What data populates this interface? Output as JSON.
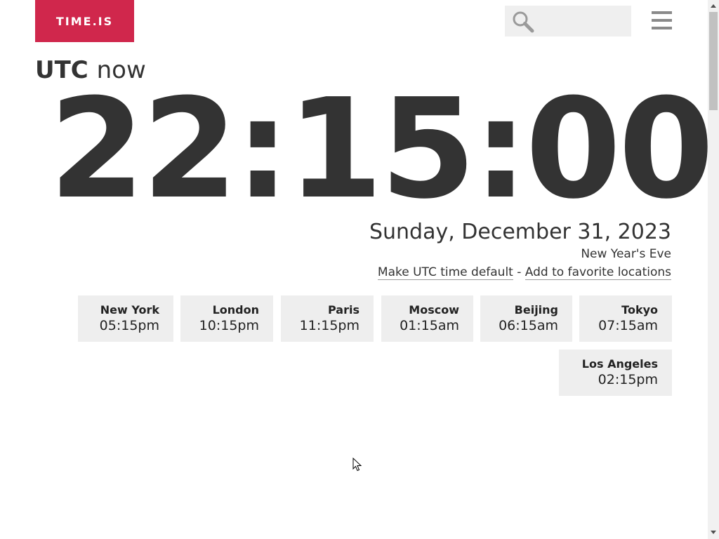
{
  "header": {
    "logo_text": "TIME.IS",
    "search_placeholder": "",
    "search_icon": "search-icon",
    "menu_icon": "hamburger-menu-icon"
  },
  "main": {
    "zone_label": "UTC",
    "now_label": "now",
    "clock_time": "22:15:00",
    "date": "Sunday, December 31, 2023",
    "holiday": "New Year's Eve",
    "link_default": "Make UTC time default",
    "link_separator": " - ",
    "link_favorite": "Add to favorite locations"
  },
  "cities": [
    {
      "name": "New York",
      "time": "05:15pm"
    },
    {
      "name": "London",
      "time": "10:15pm"
    },
    {
      "name": "Paris",
      "time": "11:15pm"
    },
    {
      "name": "Moscow",
      "time": "01:15am"
    },
    {
      "name": "Beijing",
      "time": "06:15am"
    },
    {
      "name": "Tokyo",
      "time": "07:15am"
    },
    {
      "name": "Los Angeles",
      "time": "02:15pm"
    }
  ],
  "colors": {
    "brand": "#d0274c",
    "text": "#333333",
    "tile_bg": "#eeeeee",
    "search_bg": "#efefef"
  }
}
